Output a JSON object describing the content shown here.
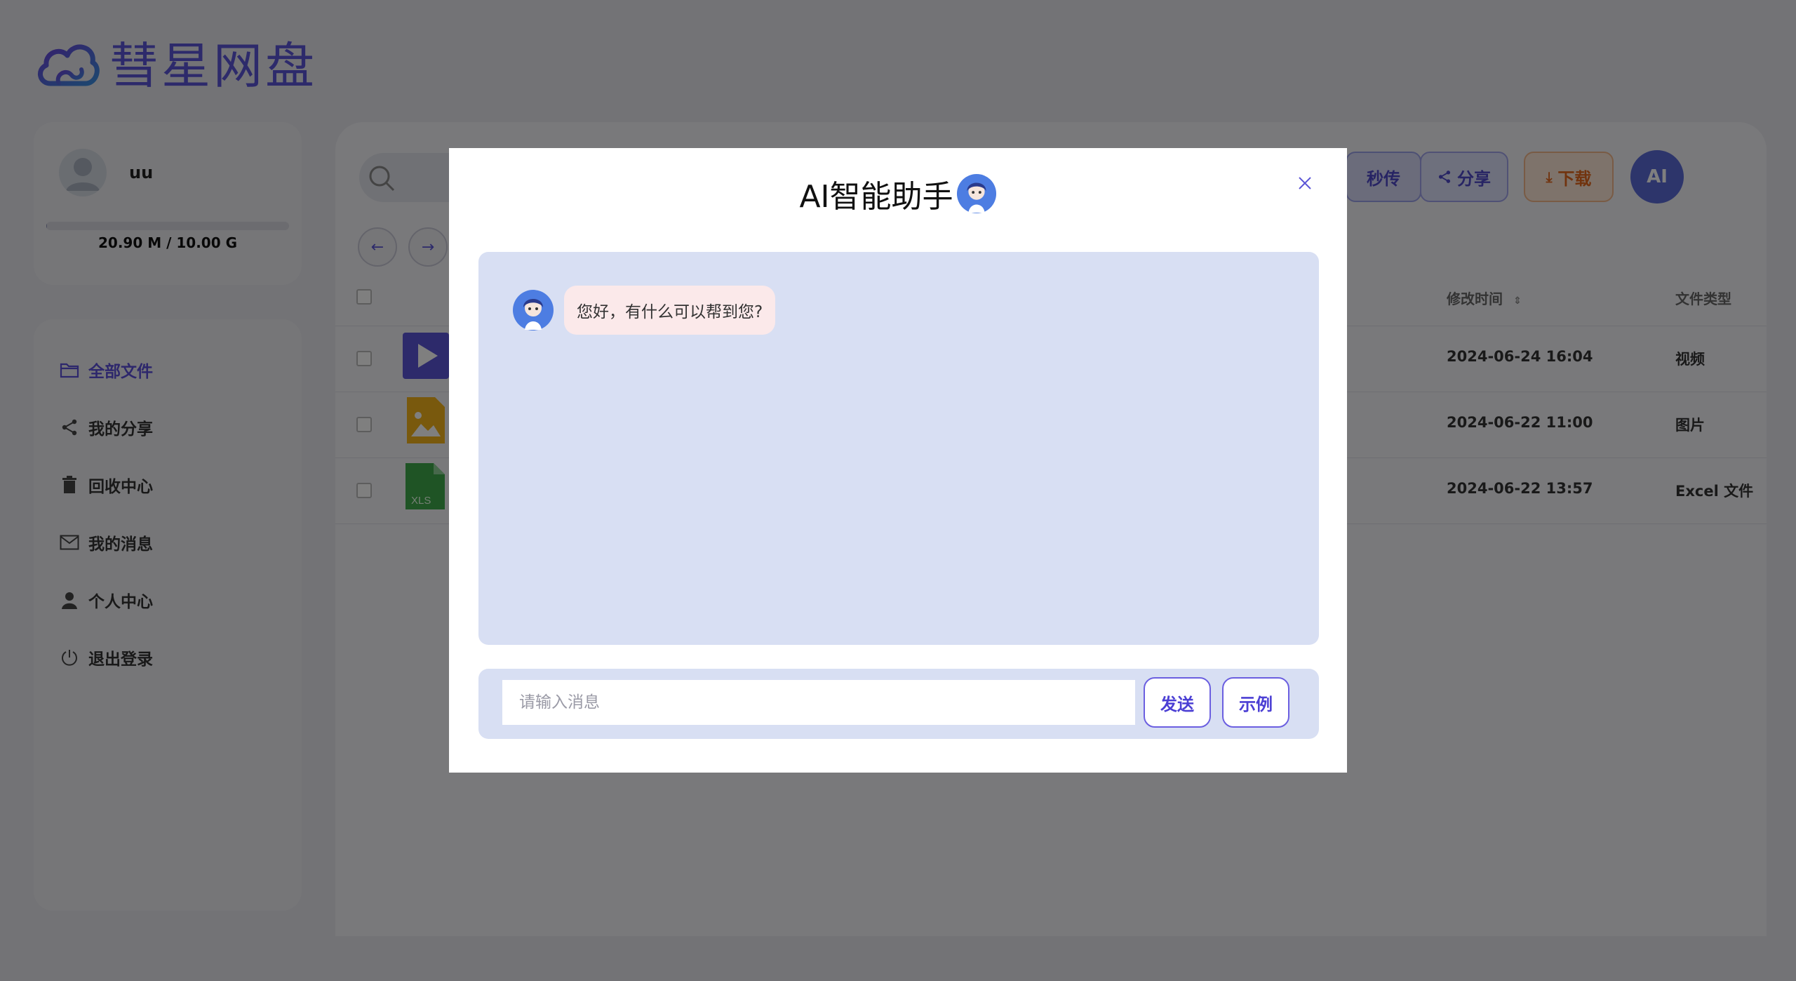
{
  "app": {
    "logo_text": "彗星网盘"
  },
  "user": {
    "name": "uu",
    "quota_text": "20.90 M / 10.00 G",
    "quota_fraction": 0.002
  },
  "nav": {
    "items": [
      {
        "label": "全部文件",
        "icon": "folder-icon",
        "active": true
      },
      {
        "label": "我的分享",
        "icon": "share-icon",
        "active": false
      },
      {
        "label": "回收中心",
        "icon": "trash-icon",
        "active": false
      },
      {
        "label": "我的消息",
        "icon": "mail-icon",
        "active": false
      },
      {
        "label": "个人中心",
        "icon": "user-icon",
        "active": false
      },
      {
        "label": "退出登录",
        "icon": "power-icon",
        "active": false
      }
    ]
  },
  "toolbar": {
    "upload_label": "秒传",
    "share_label": "分享",
    "download_label": "下载",
    "ai_label": "AI"
  },
  "table": {
    "headers": {
      "modified": "修改时间",
      "type": "文件类型"
    },
    "rows": [
      {
        "icon": "video-file-icon",
        "date": "2024-06-24 16:04",
        "type": "视频"
      },
      {
        "icon": "image-file-icon",
        "date": "2024-06-22 11:00",
        "type": "图片"
      },
      {
        "icon": "excel-file-icon",
        "date": "2024-06-22 13:57",
        "type": "Excel 文件",
        "icon_label": "XLS"
      }
    ]
  },
  "modal": {
    "title": "AI智能助手",
    "greeting": "您好，有什么可以帮到您?",
    "input_placeholder": "请输入消息",
    "send_label": "发送",
    "example_label": "示例"
  },
  "colors": {
    "accent": "#5b55d6",
    "chat_bg": "#d8dff3",
    "bubble_bg": "#fbe9ea",
    "overlay": "rgba(0,0,0,0.5)"
  }
}
